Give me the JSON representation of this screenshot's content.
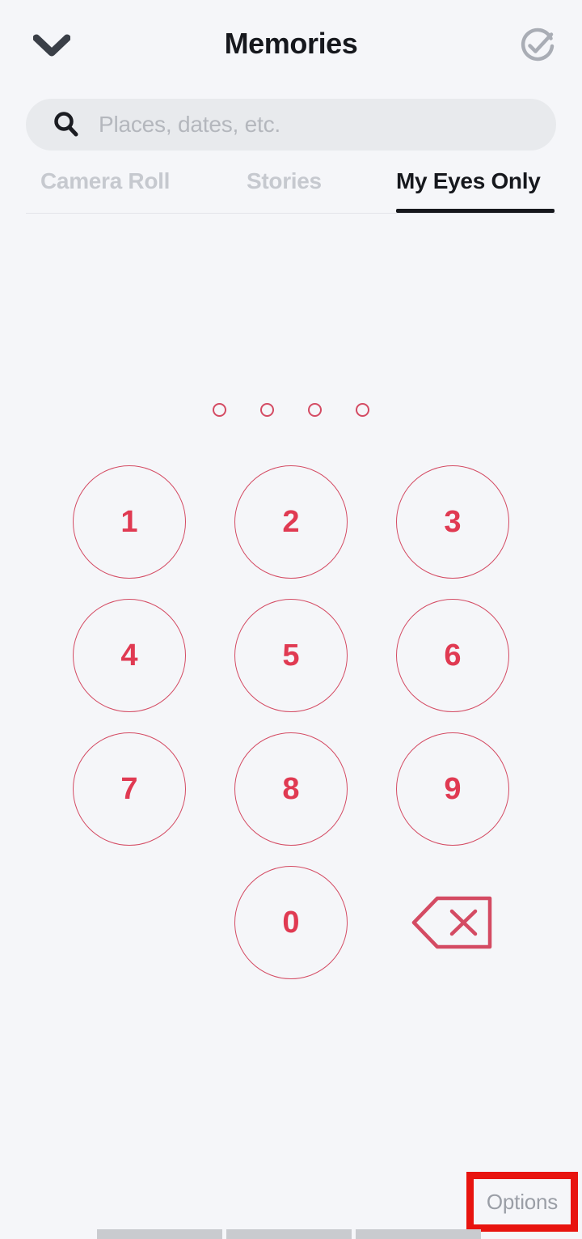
{
  "app": {
    "background_color": "#f5f6f9",
    "accent_red": "#e03a52",
    "keypad_border": "#d44b63",
    "annotation_red": "#e8140f"
  },
  "header": {
    "title": "Memories",
    "back_icon": "chevron-down-icon",
    "action_icon": "check-circle-icon"
  },
  "search": {
    "placeholder": "Places, dates, etc.",
    "value": "",
    "icon": "search-icon"
  },
  "tabs": [
    {
      "label": "Camera Roll",
      "active": false
    },
    {
      "label": "Stories",
      "active": false
    },
    {
      "label": "My Eyes Only",
      "active": true
    }
  ],
  "passcode": {
    "length": 4,
    "entered": 0,
    "dots": [
      "",
      "",
      "",
      ""
    ]
  },
  "keypad": {
    "rows": [
      [
        "1",
        "2",
        "3"
      ],
      [
        "4",
        "5",
        "6"
      ],
      [
        "7",
        "8",
        "9"
      ],
      [
        "",
        "0",
        "backspace-icon"
      ]
    ],
    "backspace_icon": "backspace-delete-icon"
  },
  "footer": {
    "options_label": "Options"
  },
  "system_bar": {
    "segments": [
      "",
      "",
      ""
    ]
  }
}
